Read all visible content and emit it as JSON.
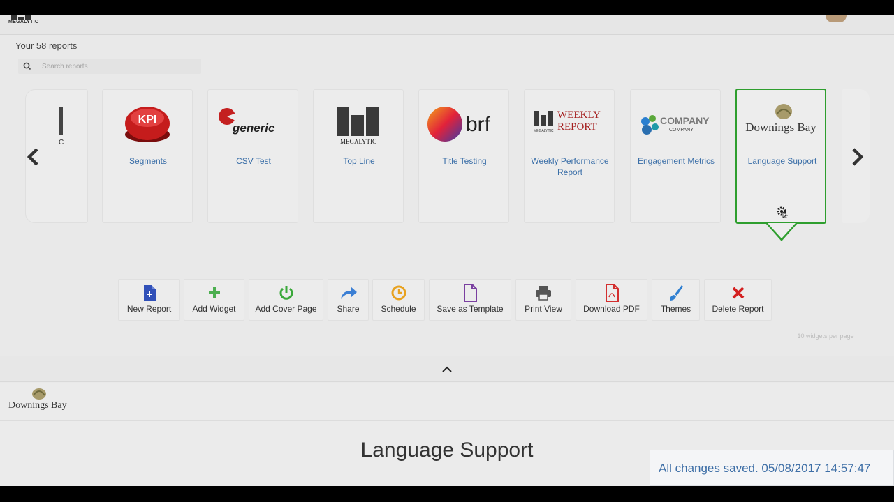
{
  "header": {
    "brand": "MEGALYTIC"
  },
  "reports": {
    "count_label": "Your 58 reports",
    "search_placeholder": "Search reports"
  },
  "cards": [
    {
      "label": "Segments",
      "logo": "kpi-button-logo"
    },
    {
      "label": "CSV Test",
      "logo": "generic-logo",
      "logo_text": "generic"
    },
    {
      "label": "Top Line",
      "logo": "megalytic-logo",
      "logo_text": "MEGALYTIC"
    },
    {
      "label": "Title Testing",
      "logo": "brf-logo",
      "logo_text": "brf"
    },
    {
      "label": "Weekly Performance Report",
      "logo": "weekly-report-logo",
      "logo_text_top": "WEEKLY",
      "logo_text_bottom": "REPORT",
      "logo_small": "MEGALYTIC"
    },
    {
      "label": "Engagement Metrics",
      "logo": "company-logo",
      "logo_text": "COMPANY",
      "logo_sub": "COMPANY"
    },
    {
      "label": "Language Support",
      "logo": "downings-bay-logo",
      "logo_text": "Downings Bay",
      "selected": true
    }
  ],
  "partial_card_left_letter": "C",
  "kpi_text": "KPI",
  "toolbar": [
    {
      "label": "New Report",
      "icon": "new-document-icon",
      "color": "#3050b8"
    },
    {
      "label": "Add Widget",
      "icon": "plus-icon",
      "color": "#4caf50"
    },
    {
      "label": "Add Cover Page",
      "icon": "power-icon",
      "color": "#3aa83a"
    },
    {
      "label": "Share",
      "icon": "share-arrow-icon",
      "color": "#3b7fd4"
    },
    {
      "label": "Schedule",
      "icon": "clock-icon",
      "color": "#e8a21f"
    },
    {
      "label": "Save as Template",
      "icon": "template-document-icon",
      "color": "#7a3fa0"
    },
    {
      "label": "Print View",
      "icon": "printer-icon",
      "color": "#555555"
    },
    {
      "label": "Download PDF",
      "icon": "pdf-icon",
      "color": "#d32f2f"
    },
    {
      "label": "Themes",
      "icon": "paintbrush-icon",
      "color": "#2f7fd1"
    },
    {
      "label": "Delete Report",
      "icon": "delete-x-icon",
      "color": "#d32020"
    }
  ],
  "per_page_label": "10 widgets per page",
  "report": {
    "logo_text": "Downings Bay",
    "title": "Language Support"
  },
  "toast": {
    "message": "All changes saved. 05/08/2017 14:57:47"
  },
  "colors": {
    "link_blue": "#3b6fa8",
    "selected_green": "#2e9e2e"
  }
}
